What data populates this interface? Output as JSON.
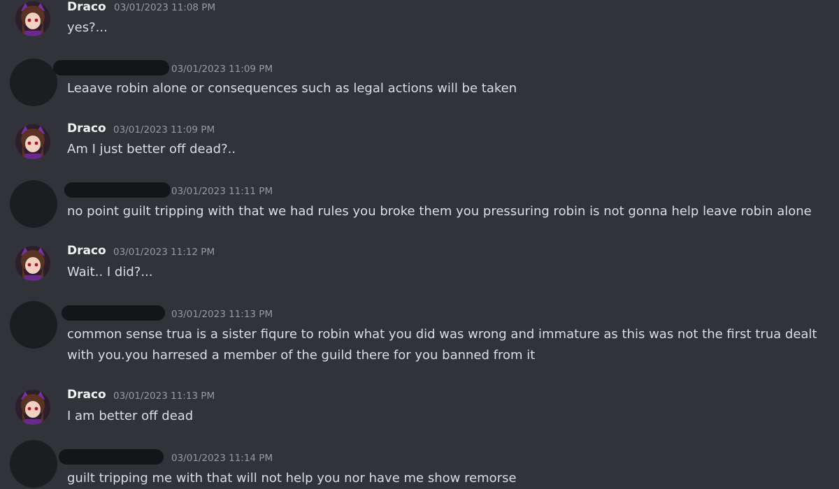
{
  "messages": [
    {
      "author": "Draco",
      "timestamp": "03/01/2023 11:08 PM",
      "text": "yes?..."
    },
    {
      "author": "",
      "timestamp": "03/01/2023 11:09 PM",
      "text": "Leaave robin alone or consequences such as legal actions will be taken"
    },
    {
      "author": "Draco",
      "timestamp": "03/01/2023 11:09 PM",
      "text": "Am I just better off dead?.."
    },
    {
      "author": "",
      "timestamp": "03/01/2023 11:11 PM",
      "text": "no point guilt tripping with that we had rules you broke them you pressuring robin is not gonna help leave robin alone"
    },
    {
      "author": "Draco",
      "timestamp": "03/01/2023 11:12 PM",
      "text": "Wait.. I did?..."
    },
    {
      "author": "",
      "timestamp": "03/01/2023 11:13 PM",
      "text": "common sense trua is a sister fiqure to robin what you did was wrong and immature as this was not the first trua dealt with you.you harresed a member of the guild there for you banned from it"
    },
    {
      "author": "Draco",
      "timestamp": "03/01/2023 11:13 PM",
      "text": "I am better off dead"
    },
    {
      "author": "",
      "timestamp": "03/01/2023 11:14 PM",
      "text": "guilt tripping me with that will not help you nor have me show remorse"
    }
  ]
}
